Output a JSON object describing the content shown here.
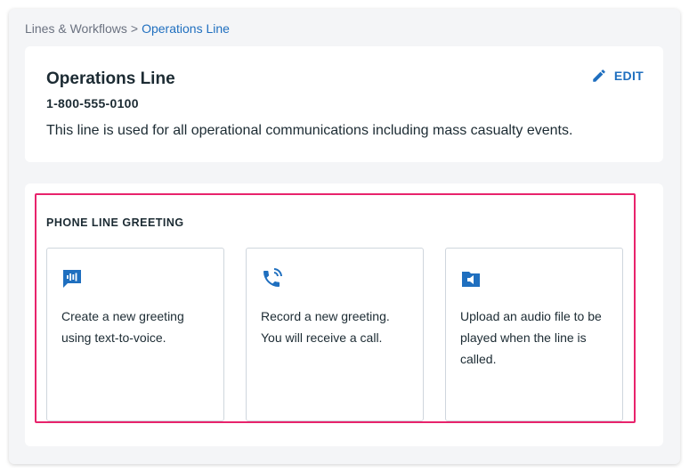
{
  "breadcrumb": {
    "parent": "Lines & Workflows",
    "separator": ">",
    "current": "Operations Line"
  },
  "line": {
    "title": "Operations Line",
    "phone": "1-800-555-0100",
    "description": "This line is used for all operational communications including mass casualty events.",
    "edit_label": "EDIT"
  },
  "greeting": {
    "section_title": "PHONE LINE GREETING",
    "options": [
      {
        "icon": "text-to-voice-icon",
        "text": "Create a new greeting using text-to-voice."
      },
      {
        "icon": "phone-call-icon",
        "text": "Record a new greeting. You will receive a call."
      },
      {
        "icon": "audio-file-icon",
        "text": "Upload an audio file to be played when the line is called."
      }
    ]
  },
  "colors": {
    "accent": "#1f6fbf",
    "highlight": "#e8236c",
    "text": "#1c2b33"
  }
}
